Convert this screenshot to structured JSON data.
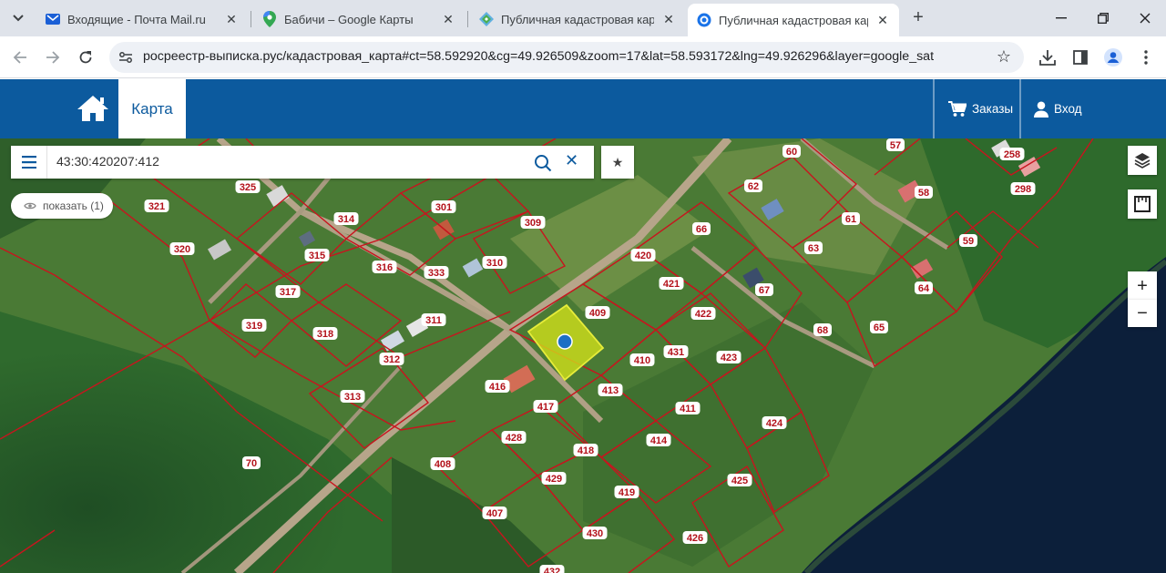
{
  "browser": {
    "tabs": [
      {
        "title": "Входящие - Почта Mail.ru",
        "icon": "mail-icon",
        "active": false
      },
      {
        "title": "Бабичи – Google Карты",
        "icon": "google-maps-icon",
        "active": false
      },
      {
        "title": "Публичная кадастровая карта",
        "icon": "cadastre-icon",
        "active": false
      },
      {
        "title": "Публичная кадастровая карта",
        "icon": "globe-icon",
        "active": true
      }
    ],
    "url": "росреестр-выписка.рус/кадастровая_карта#ct=58.592920&cg=49.926509&zoom=17&lat=58.593172&lng=49.926296&layer=google_sat"
  },
  "site": {
    "nav_map_label": "Карта",
    "orders_label": "Заказы",
    "login_label": "Вход",
    "accent_color": "#0c5a9e"
  },
  "map": {
    "search_value": "43:30:420207:412",
    "show_button_label": "показать (1)",
    "zoom_in_label": "+",
    "zoom_out_label": "−",
    "highlight_color": "#d4e21a",
    "parcel_labels": [
      "325",
      "321",
      "320",
      "314",
      "301",
      "309",
      "310",
      "315",
      "316",
      "333",
      "317",
      "311",
      "319",
      "318",
      "312",
      "313",
      "70",
      "408",
      "407",
      "428",
      "429",
      "430",
      "417",
      "418",
      "419",
      "416",
      "413",
      "414",
      "411",
      "410",
      "409",
      "420",
      "421",
      "422",
      "423",
      "424",
      "425",
      "426",
      "431",
      "66",
      "62",
      "60",
      "57",
      "58",
      "298",
      "258",
      "61",
      "63",
      "67",
      "68",
      "59",
      "64",
      "65",
      "432"
    ]
  }
}
